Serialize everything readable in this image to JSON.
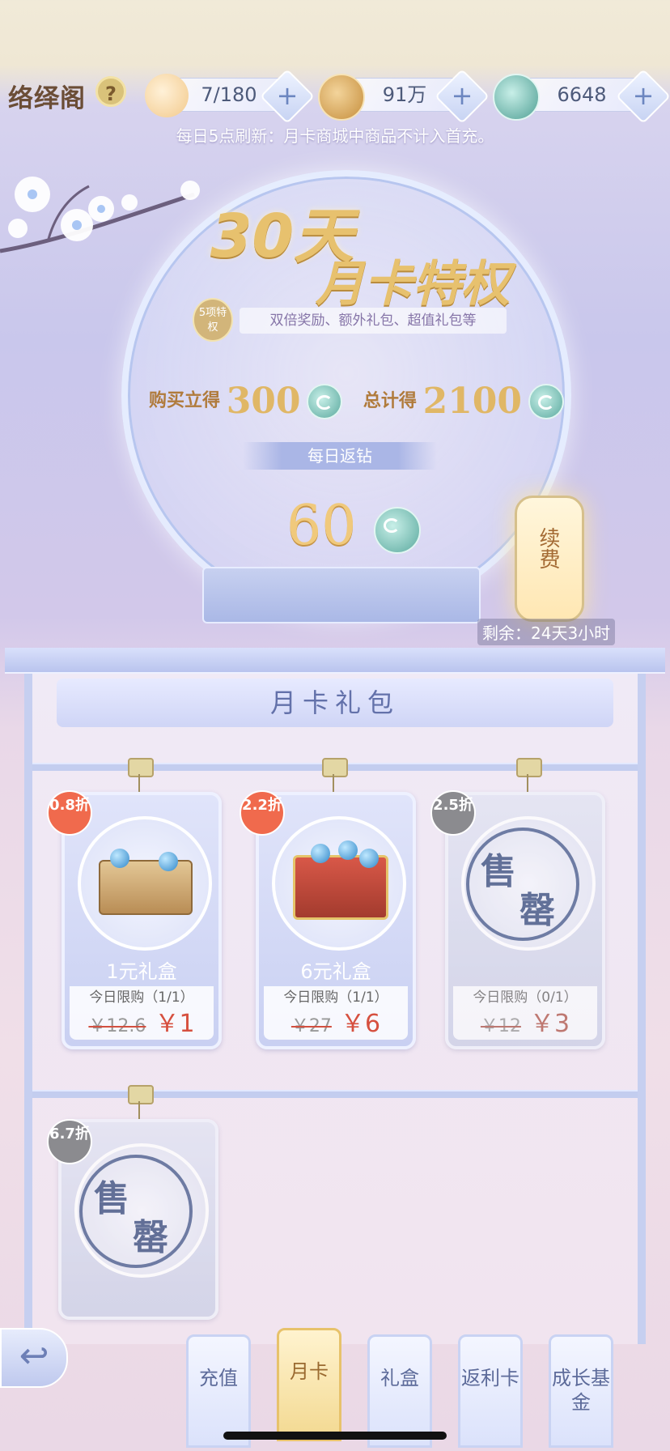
{
  "header": {
    "title": "络绎阁",
    "help_glyph": "?",
    "resources": [
      {
        "name": "stamina",
        "icon": "cat-face-icon",
        "value": "7/180"
      },
      {
        "name": "coins",
        "icon": "paw-coin-icon",
        "value": "91万"
      },
      {
        "name": "gems",
        "icon": "jade-gem-icon",
        "value": "6648"
      }
    ],
    "plus_glyph": "+",
    "notice": "每日5点刷新：月卡商城中商品不计入首充。"
  },
  "monthcard": {
    "title_days": "30天",
    "title_privilege": "月卡特权",
    "badge": "5项特权",
    "features": "双倍奖励、额外礼包、超值礼包等",
    "buy_label": "购买立得",
    "buy_amount": "300",
    "total_label": "总计得",
    "total_amount": "2100",
    "daily_label": "每日返钻",
    "daily_amount": "60",
    "renew_label": "续费",
    "remaining": "剩余：24天3小时"
  },
  "gift_section": {
    "title": "月卡礼包",
    "cards": [
      {
        "discount": "0.8折",
        "name": "1元礼盒",
        "limit": "今日限购（1/1）",
        "old_price": "￥12.6",
        "new_price": "￥1",
        "sold_out": false
      },
      {
        "discount": "2.2折",
        "name": "6元礼盒",
        "limit": "今日限购（1/1）",
        "old_price": "￥27",
        "new_price": "￥6",
        "sold_out": false
      },
      {
        "discount": "2.5折",
        "name": "",
        "limit": "今日限购（0/1）",
        "old_price": "￥12",
        "new_price": "￥3",
        "sold_out": true
      },
      {
        "discount": "6.7折",
        "name": "",
        "limit": "",
        "old_price": "",
        "new_price": "",
        "sold_out": true
      }
    ],
    "sold_out_text_1": "售",
    "sold_out_text_2": "罄"
  },
  "nav": {
    "back_glyph": "↩",
    "tabs": [
      {
        "label": "充值",
        "active": false
      },
      {
        "label": "月卡",
        "active": true
      },
      {
        "label": "礼盒",
        "active": false
      },
      {
        "label": "返利卡",
        "active": false
      },
      {
        "label": "成长基金",
        "active": false
      }
    ]
  },
  "colors": {
    "accent_gold": "#e0b766",
    "price_red": "#d6503f",
    "discount_orange": "#f06a4d",
    "frame_blue": "#c6cff0"
  }
}
